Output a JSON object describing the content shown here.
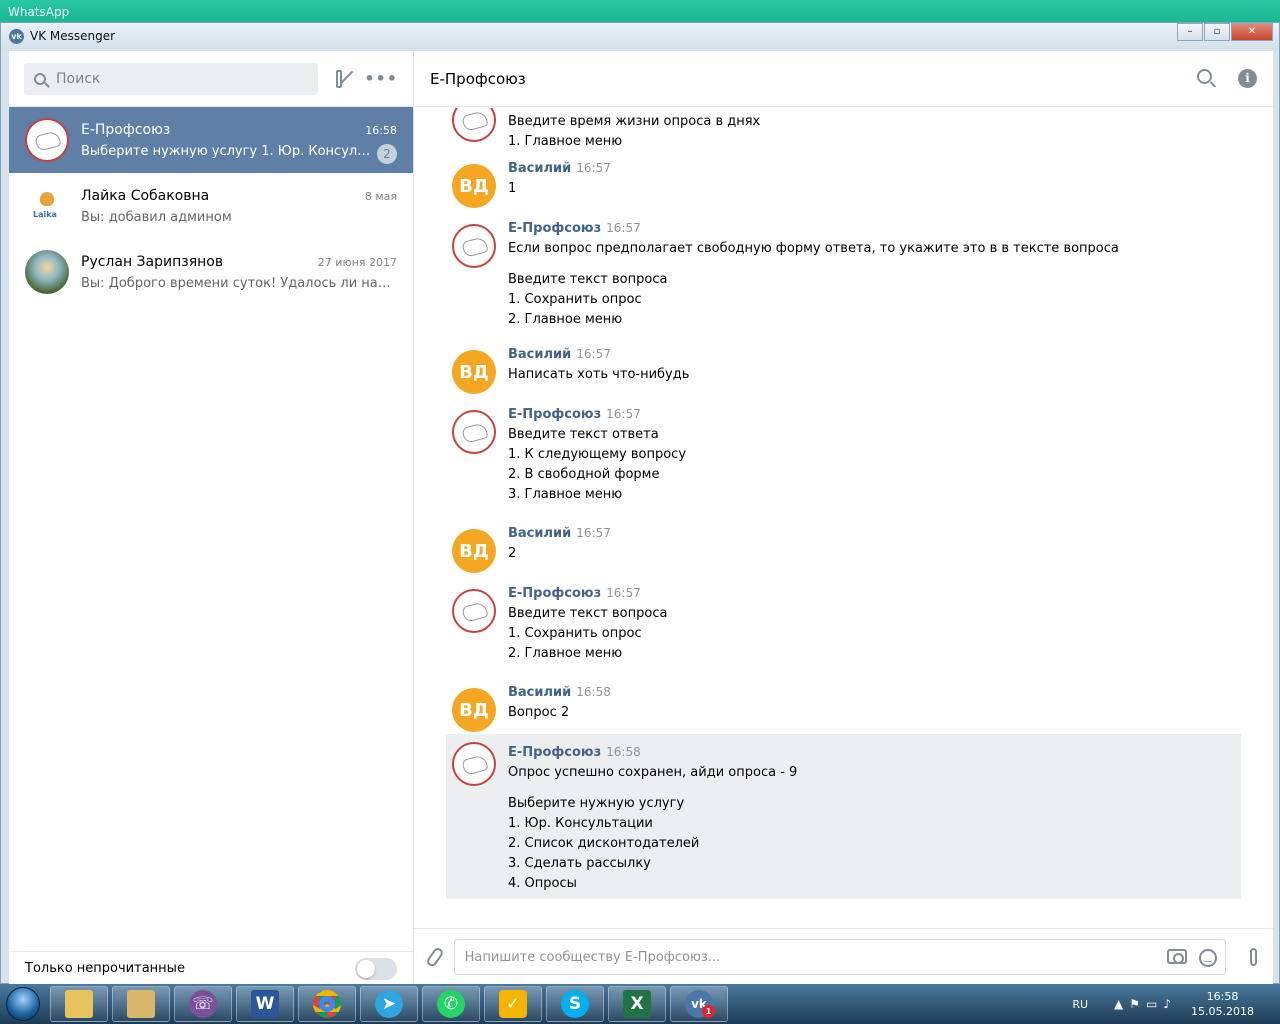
{
  "top_window": {
    "title": "WhatsApp"
  },
  "window": {
    "title": "VK Messenger",
    "controls": [
      "–",
      "▫",
      "✕"
    ]
  },
  "sidebar": {
    "search_placeholder": "Поиск",
    "conversations": [
      {
        "name": "Е-Профсоюз",
        "time": "16:58",
        "preview": "Выберите нужную услугу 1. Юр. Консультац...",
        "unread": "2",
        "active": true
      },
      {
        "name": "Лайка Собаковна",
        "time": "8 мая",
        "preview": "Вы: добавил админом"
      },
      {
        "name": "Руслан Зарипзянов",
        "time": "27 июня 2017",
        "preview": "Вы: Доброго времени суток! Удалось ли наброс..."
      }
    ],
    "unread_only_label": "Только непрочитанные"
  },
  "chat": {
    "title": "Е-Профсоюз",
    "messages": [
      {
        "author": "",
        "time": "",
        "lines": [
          "Введите время жизни опроса в днях",
          "1. Главное меню"
        ]
      },
      {
        "author": "Василий",
        "initials": "ВД",
        "time": "16:57",
        "lines": [
          "1"
        ]
      },
      {
        "author": "Е-Профсоюз",
        "time": "16:57",
        "lines": [
          "Если вопрос предполагает свободную форму ответа, то укажите это в в тексте вопроса",
          "Введите текст вопроса",
          "1. Сохранить опрос",
          "2. Главное меню"
        ]
      },
      {
        "author": "Василий",
        "initials": "ВД",
        "time": "16:57",
        "lines": [
          "Написать хоть что-нибудь"
        ]
      },
      {
        "author": "Е-Профсоюз",
        "time": "16:57",
        "lines": [
          "Введите текст ответа",
          "1. К следующему вопросу",
          "2. В свободной форме",
          "3. Главное меню"
        ]
      },
      {
        "author": "Василий",
        "initials": "ВД",
        "time": "16:57",
        "lines": [
          "2"
        ]
      },
      {
        "author": "Е-Профсоюз",
        "time": "16:57",
        "lines": [
          "Введите текст вопроса",
          "1. Сохранить опрос",
          "2. Главное меню"
        ]
      },
      {
        "author": "Василий",
        "initials": "ВД",
        "time": "16:58",
        "lines": [
          "Вопрос 2"
        ]
      },
      {
        "author": "Е-Профсоюз",
        "time": "16:58",
        "lines": [
          "Опрос успешно сохранен, айди опроса - 9",
          "Выберите нужную услугу",
          "1. Юр. Консультации",
          "2. Список дисконтодателей",
          "3. Сделать рассылку",
          "4. Опросы"
        ]
      }
    ],
    "input_placeholder": "Напишите сообществу Е-Профсоюз..."
  },
  "taskbar": {
    "apps": [
      "explorer",
      "file-manager",
      "viber",
      "word",
      "chrome",
      "telegram",
      "whatsapp",
      "tasks",
      "skype",
      "excel",
      "vk"
    ],
    "vk_badge": "1",
    "language": "RU",
    "time": "16:58",
    "date": "15.05.2018"
  }
}
